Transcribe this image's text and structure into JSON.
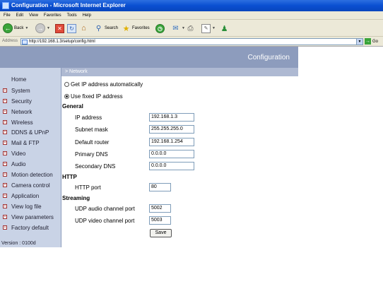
{
  "window": {
    "title": "Configuration - Microsoft Internet Explorer"
  },
  "menubar": {
    "items": [
      "File",
      "Edit",
      "View",
      "Favorites",
      "Tools",
      "Help"
    ]
  },
  "toolbar": {
    "back": "Back",
    "search": "Search",
    "favorites": "Favorites"
  },
  "addressbar": {
    "label": "Address",
    "url": "http://192.168.1.3/setup/config.html",
    "go": "Go"
  },
  "header": {
    "title": "Configuration"
  },
  "sidebar": {
    "home": "Home",
    "items": [
      "System",
      "Security",
      "Network",
      "Wireless",
      "DDNS & UPnP",
      "Mail & FTP",
      "Video",
      "Audio",
      "Motion detection",
      "Camera control",
      "Application",
      "View log file",
      "View parameters",
      "Factory default"
    ],
    "version": "Version : 0100d"
  },
  "main": {
    "breadcrumb": "> Network",
    "ip_auto_label": "Get IP address automatically",
    "ip_fixed_label": "Use fixed IP address",
    "selected_ip_mode": "fixed",
    "general_title": "General",
    "ip_address_label": "IP address",
    "ip_address": "192.168.1.3",
    "subnet_label": "Subnet mask",
    "subnet": "255.255.255.0",
    "router_label": "Default router",
    "router": "192.168.1.254",
    "primary_dns_label": "Primary DNS",
    "primary_dns": "0.0.0.0",
    "secondary_dns_label": "Secondary DNS",
    "secondary_dns": "0.0.0.0",
    "http_title": "HTTP",
    "http_port_label": "HTTP port",
    "http_port": "80",
    "streaming_title": "Streaming",
    "udp_audio_label": "UDP audio channel port",
    "udp_audio": "5002",
    "udp_video_label": "UDP video channel port",
    "udp_video": "5003",
    "save_label": "Save"
  }
}
